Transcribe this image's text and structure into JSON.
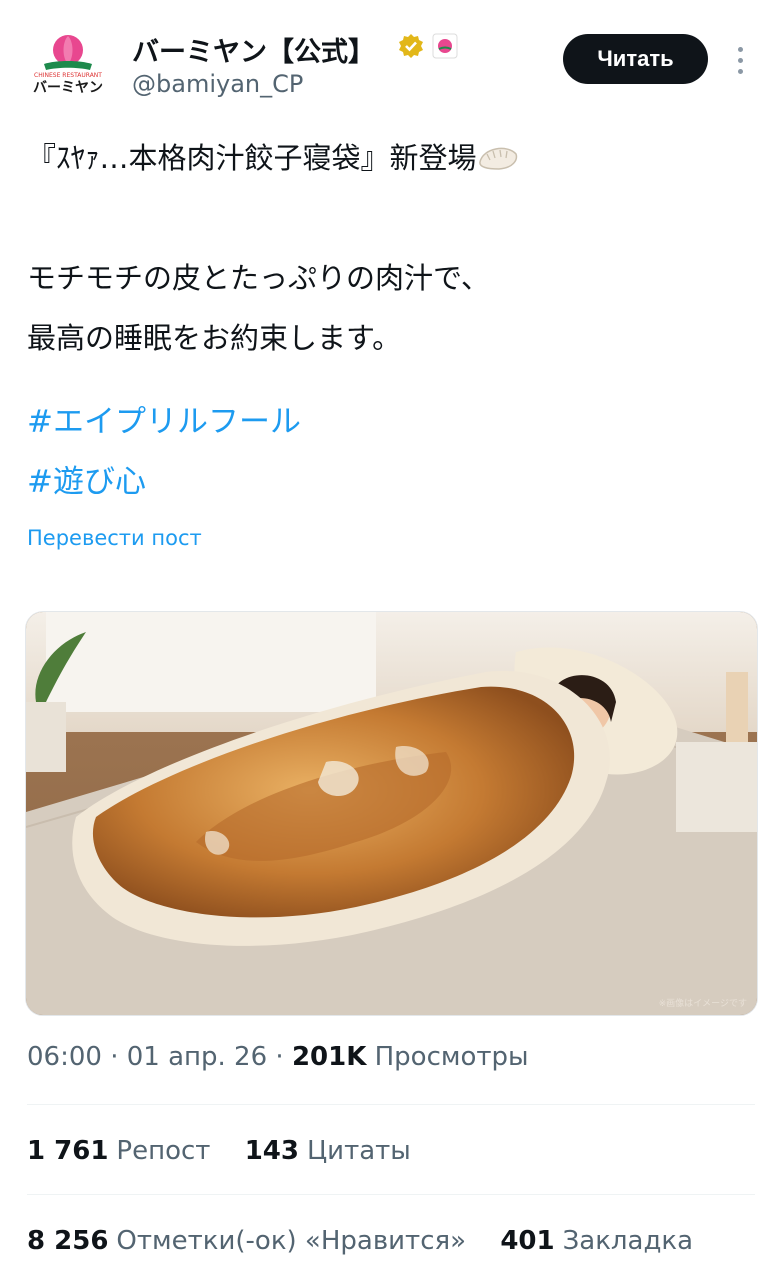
{
  "account": {
    "display_name": "バーミヤン【公式】",
    "handle": "@bamiyan_CP",
    "logo_caption": "CHINESE RESTAURANT",
    "logo_text": "バーミヤン",
    "verified_icon": "verified-gold-badge-icon",
    "affiliate_icon": "affiliate-badge-icon"
  },
  "follow_button": {
    "label": "Читать"
  },
  "more_icon": "more-vertical-icon",
  "post": {
    "line1": "『ｽﾔｧ…本格肉汁餃子寝袋』新登場",
    "line1_emoji": "dumpling-emoji-icon",
    "line2": "モチモチの皮とたっぷりの肉汁で、",
    "line3": "最高の睡眠をお約束します。",
    "hashtags": [
      "#エイプリルフール",
      "#遊び心"
    ],
    "translate_label": "Перевести пост"
  },
  "media": {
    "description_icon": "photo-image",
    "watermark": "※画像はイメージです"
  },
  "meta": {
    "time": "06:00",
    "date": "01 апр. 26",
    "views_count": "201K",
    "views_label": "Просмотры"
  },
  "stats_row1": {
    "reposts_count": "1 761",
    "reposts_label": "Репост",
    "quotes_count": "143",
    "quotes_label": "Цитаты"
  },
  "stats_row2": {
    "likes_count": "8 256",
    "likes_label": "Отметки(-ок) «Нравится»",
    "bookmarks_count": "401",
    "bookmarks_label": "Закладка"
  },
  "colors": {
    "link_blue": "#1d9bf0",
    "text_dark": "#0f1419",
    "text_gray": "#536471",
    "button_black": "#0f1419"
  }
}
